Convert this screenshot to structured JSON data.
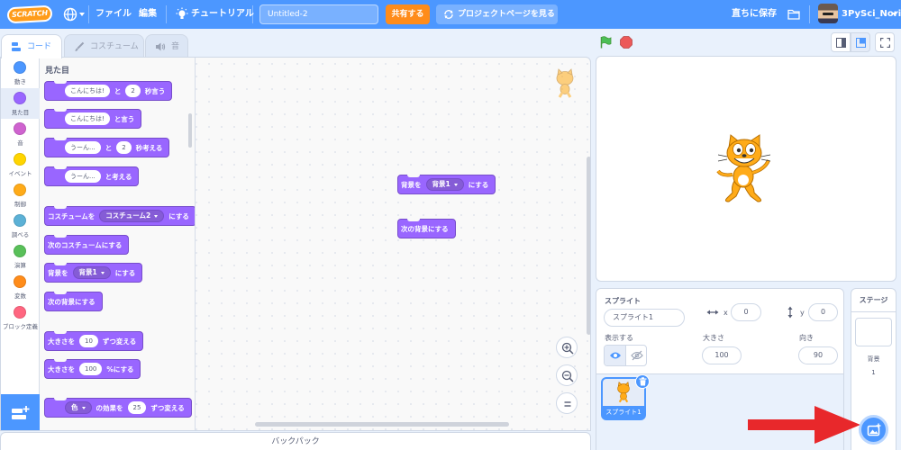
{
  "menubar": {
    "logo": "SCRATCH",
    "file": "ファイル",
    "edit": "編集",
    "tutorials": "チュートリアル",
    "project_title": "Untitled-2",
    "share": "共有する",
    "project_page": "プロジェクトページを見る",
    "save_now": "直ちに保存",
    "username": "3PySci_Nori"
  },
  "tabs": {
    "code": "コード",
    "costumes": "コスチューム",
    "sounds": "音"
  },
  "categories": [
    {
      "label": "動き",
      "color": "#4c97ff"
    },
    {
      "label": "見た目",
      "color": "#9966ff"
    },
    {
      "label": "音",
      "color": "#cf63cf"
    },
    {
      "label": "イベント",
      "color": "#ffd500"
    },
    {
      "label": "制御",
      "color": "#ffab19"
    },
    {
      "label": "調べる",
      "color": "#5cb1d6"
    },
    {
      "label": "演算",
      "color": "#59c059"
    },
    {
      "label": "変数",
      "color": "#ff8c1a"
    },
    {
      "label": "ブロック定義",
      "color": "#ff6680"
    }
  ],
  "palette": {
    "heading": "見た目",
    "b1": {
      "msg": "こんにちは!",
      "mid": "と",
      "secs": "2",
      "end": "秒言う"
    },
    "b2": {
      "msg": "こんにちは!",
      "end": "と言う"
    },
    "b3": {
      "msg": "うーん...",
      "mid": "と",
      "secs": "2",
      "end": "秒考える"
    },
    "b4": {
      "msg": "うーん...",
      "end": "と考える"
    },
    "b5": {
      "pre": "コスチュームを",
      "menu": "コスチューム2",
      "end": "にする"
    },
    "b6": {
      "text": "次のコスチュームにする"
    },
    "b7": {
      "pre": "背景を",
      "menu": "背景1",
      "end": "にする"
    },
    "b8": {
      "text": "次の背景にする"
    },
    "b9": {
      "pre": "大きさを",
      "val": "10",
      "end": "ずつ変える"
    },
    "b10": {
      "pre": "大きさを",
      "val": "100",
      "end": "%にする"
    },
    "b11": {
      "menu": "色",
      "mid": "の効果を",
      "val": "25",
      "end": "ずつ変える"
    }
  },
  "script": {
    "s1": {
      "pre": "背景を",
      "menu": "背景1",
      "end": "にする"
    },
    "s2": {
      "text": "次の背景にする"
    }
  },
  "backpack": "バックパック",
  "sprite_info": {
    "label": "スプライト",
    "name": "スプライト1",
    "x_label": "x",
    "x": "0",
    "y_label": "y",
    "y": "0",
    "show_label": "表示する",
    "size_label": "大きさ",
    "size": "100",
    "direction_label": "向き",
    "direction": "90",
    "thumb_name": "スプライト1"
  },
  "stage_selector": {
    "header": "ステージ",
    "backdrops_label": "背景",
    "backdrops_count": "1"
  },
  "colors": {
    "menubar": "#4c97ff",
    "share": "#ff8c1a",
    "looks": "#9966ff",
    "arrow": "#e8282b"
  }
}
